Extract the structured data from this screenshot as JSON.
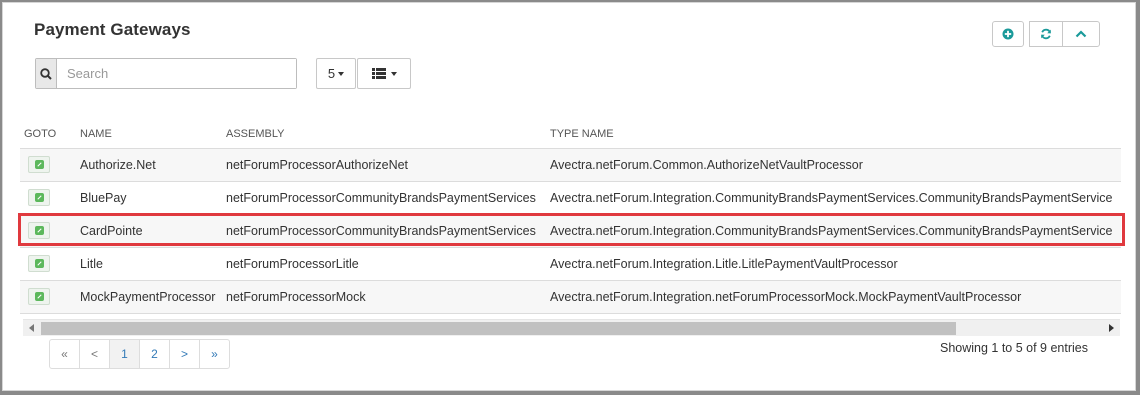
{
  "panel": {
    "title": "Payment Gateways"
  },
  "search": {
    "placeholder": "Search",
    "value": ""
  },
  "toolbar": {
    "page_size": "5"
  },
  "table": {
    "columns": [
      "GOTO",
      "NAME",
      "ASSEMBLY",
      "TYPE NAME"
    ],
    "rows": [
      {
        "name": "Authorize.Net",
        "assembly": "netForumProcessorAuthorizeNet",
        "type_name": "Avectra.netForum.Common.AuthorizeNetVaultProcessor"
      },
      {
        "name": "BluePay",
        "assembly": "netForumProcessorCommunityBrandsPaymentServices",
        "type_name": "Avectra.netForum.Integration.CommunityBrandsPaymentServices.CommunityBrandsPaymentService"
      },
      {
        "name": "CardPointe",
        "assembly": "netForumProcessorCommunityBrandsPaymentServices",
        "type_name": "Avectra.netForum.Integration.CommunityBrandsPaymentServices.CommunityBrandsPaymentService"
      },
      {
        "name": "Litle",
        "assembly": "netForumProcessorLitle",
        "type_name": "Avectra.netForum.Integration.Litle.LitlePaymentVaultProcessor"
      },
      {
        "name": "MockPaymentProcessor",
        "assembly": "netForumProcessorMock",
        "type_name": "Avectra.netForum.Integration.netForumProcessorMock.MockPaymentVaultProcessor"
      }
    ]
  },
  "pagination": {
    "first": "«",
    "prev": "<",
    "pages": [
      "1",
      "2"
    ],
    "next": ">",
    "last": "»",
    "current_page": "1",
    "summary": "Showing 1 to 5 of 9 entries"
  },
  "colors": {
    "accent": "#1a9a9a",
    "highlight": "#e0393e"
  },
  "icons": [
    "add-circle-icon",
    "refresh-icon",
    "chevron-up-icon",
    "search-icon",
    "list-view-icon",
    "goto-edit-icon"
  ]
}
